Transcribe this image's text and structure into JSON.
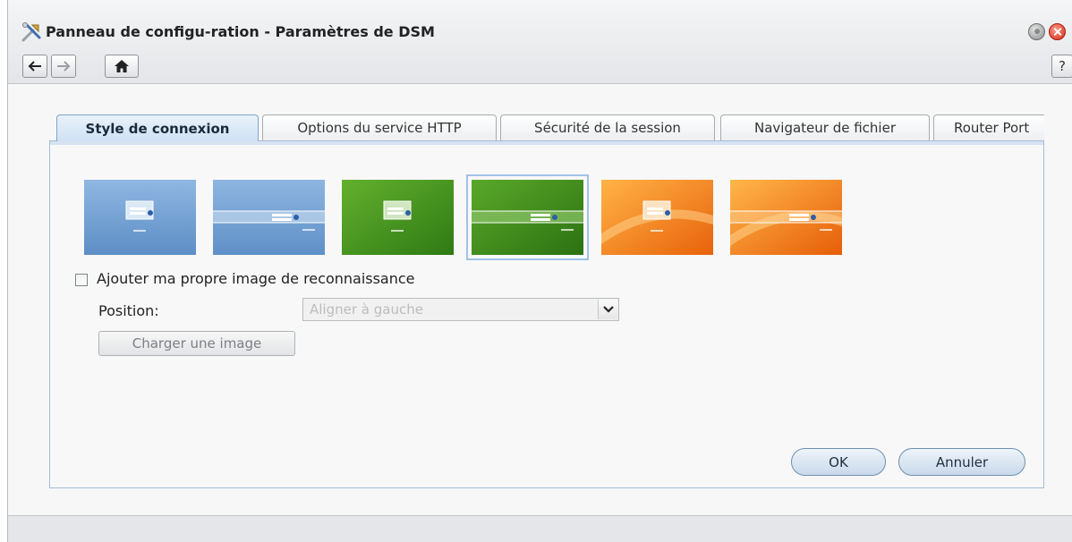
{
  "window": {
    "title": "Panneau de configu-ration - Paramètres de DSM",
    "help_label": "?"
  },
  "tabs": [
    {
      "label": "Style de connexion",
      "active": true
    },
    {
      "label": "Options du service HTTP",
      "active": false
    },
    {
      "label": "Sécurité de la session",
      "active": false
    },
    {
      "label": "Navigateur de fichier",
      "active": false
    },
    {
      "label": "Router Port",
      "active": false
    }
  ],
  "login_styles": [
    {
      "theme": "blue",
      "layout": "box",
      "selected": false
    },
    {
      "theme": "blue",
      "layout": "banner",
      "selected": false
    },
    {
      "theme": "green",
      "layout": "box",
      "selected": false
    },
    {
      "theme": "green",
      "layout": "banner",
      "selected": true
    },
    {
      "theme": "orange",
      "layout": "box",
      "selected": false
    },
    {
      "theme": "orange",
      "layout": "banner",
      "selected": false
    }
  ],
  "custom_image": {
    "checkbox_label": "Ajouter ma propre image de reconnaissance",
    "checked": false,
    "position_label": "Position:",
    "position_value": "Aligner à gauche",
    "upload_label": "Charger une image"
  },
  "actions": {
    "ok_label": "OK",
    "cancel_label": "Annuler"
  },
  "colors": {
    "accent_blue": "#7fa5c9",
    "close_red": "#d32a16",
    "theme_blue": "#6f9fd3",
    "theme_green": "#3e8a1e",
    "theme_orange": "#f08a12"
  }
}
